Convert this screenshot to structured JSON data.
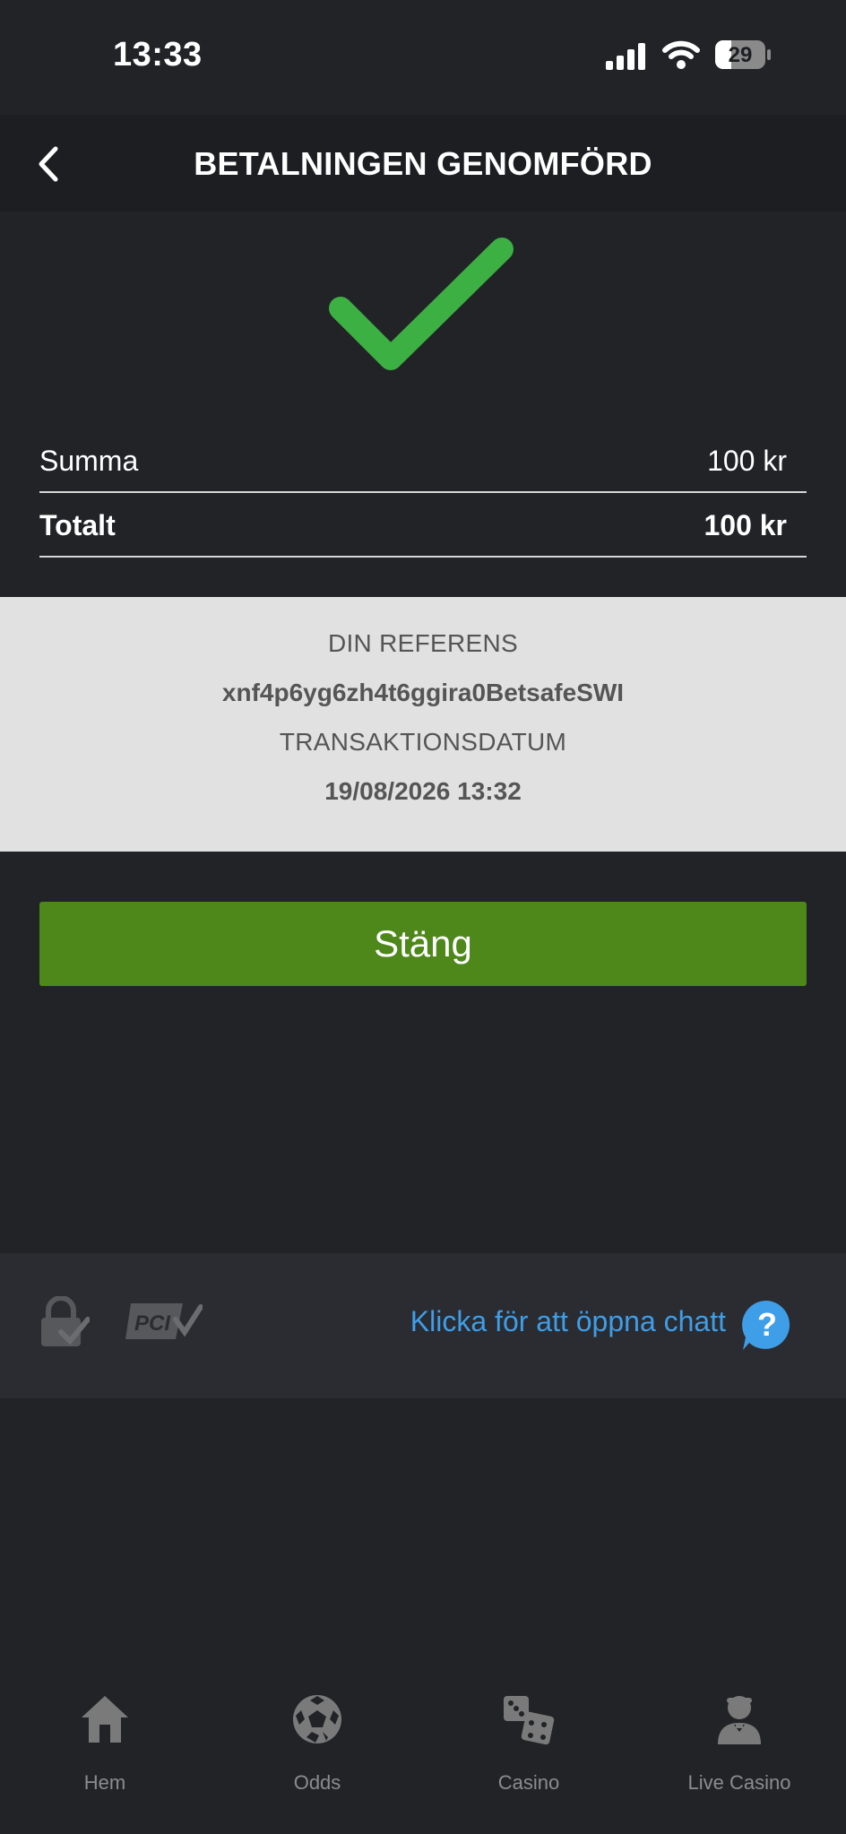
{
  "status_bar": {
    "time": "13:33",
    "battery": "29"
  },
  "header": {
    "title": "BETALNINGEN GENOMFÖRD",
    "back_icon": "chevron-left-icon"
  },
  "success_icon": "checkmark-icon",
  "colors": {
    "success": "#3cb043",
    "button": "#4e871a",
    "link": "#3f9ee8",
    "background": "#212327"
  },
  "summary": {
    "sum_label": "Summa",
    "sum_value": "100 kr",
    "total_label": "Totalt",
    "total_value": "100 kr"
  },
  "reference": {
    "ref_caption": "DIN REFERENS",
    "ref_value": "xnf4p6yg6zh4t6ggira0BetsafeSWI",
    "date_caption": "TRANSAKTIONSDATUM",
    "date_value": "19/08/2026 13:32"
  },
  "close_button": "Stäng",
  "footer": {
    "chat_link": "Klicka för att öppna chatt",
    "help_mark": "?",
    "pci_text": "PCI"
  },
  "tabs": [
    {
      "label": "Hem",
      "icon": "home-icon"
    },
    {
      "label": "Odds",
      "icon": "soccer-ball-icon"
    },
    {
      "label": "Casino",
      "icon": "dice-icon"
    },
    {
      "label": "Live Casino",
      "icon": "dealer-icon"
    }
  ]
}
